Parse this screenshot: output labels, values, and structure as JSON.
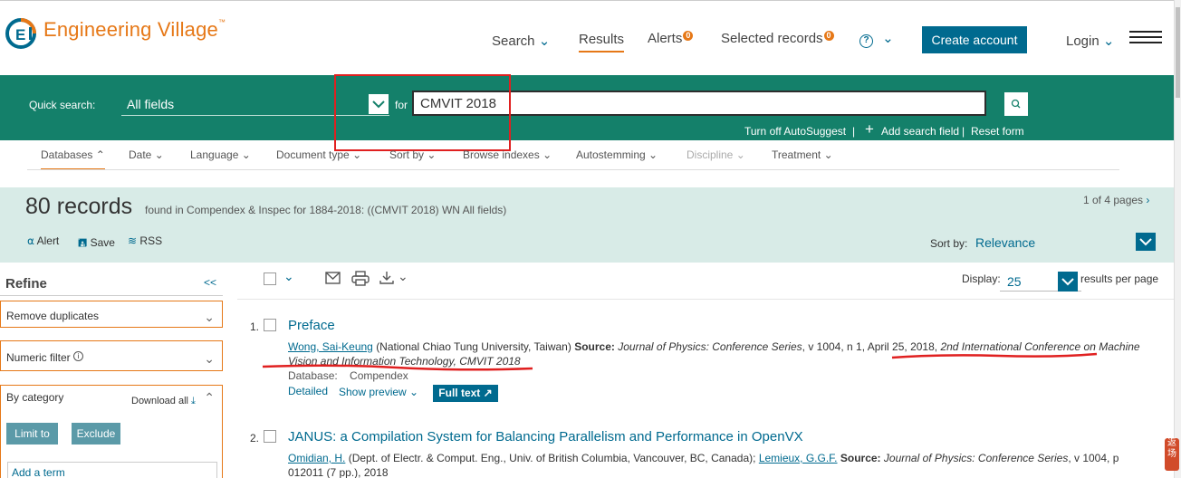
{
  "header": {
    "logo_text": "Engineering Village",
    "logo_tm": "™",
    "nav": {
      "search": "Search",
      "results": "Results",
      "alerts": "Alerts",
      "alerts_count": "0",
      "selected": "Selected records",
      "selected_count": "0",
      "help": "?",
      "create_account": "Create account",
      "login": "Login"
    }
  },
  "search": {
    "quick_label": "Quick search:",
    "field": "All fields",
    "for_label": "for",
    "query": "CMVIT 2018",
    "autosuggest": "Turn off AutoSuggest",
    "add_field": "Add search field",
    "reset": "Reset form"
  },
  "filters": [
    "Databases",
    "Date",
    "Language",
    "Document type",
    "Sort by",
    "Browse indexes",
    "Autostemming",
    "Discipline",
    "Treatment"
  ],
  "summary": {
    "count": "80 records",
    "found": "found in Compendex & Inspec for 1884-2018: ((CMVIT 2018) WN All fields)",
    "pages": "1 of 4 pages",
    "alert": "Alert",
    "save": "Save",
    "rss": "RSS",
    "sort_label": "Sort by:",
    "sort_value": "Relevance"
  },
  "refine": {
    "title": "Refine",
    "collapse": "<<",
    "remove_duplicates": "Remove duplicates",
    "numeric_filter": "Numeric filter",
    "by_category": "By category",
    "download_all": "Download all",
    "limit_to": "Limit to",
    "exclude": "Exclude",
    "add_term": "Add a term"
  },
  "toolbar": {
    "display_label": "Display:",
    "display_value": "25",
    "results_per_page": "results per page"
  },
  "results": [
    {
      "num": "1.",
      "title": "Preface",
      "author": "Wong, Sai-Keung",
      "affil": "(National Chiao Tung University, Taiwan)",
      "source_label": "Source:",
      "source": "Journal of Physics: Conference Series",
      "source_tail": ", v 1004, n 1, April 25, 2018,",
      "conf1": "2nd International Conference on Machine",
      "conf2": "Vision and Information Technology, CMVIT 2018",
      "db_label": "Database:",
      "db_value": "Compendex",
      "detailed": "Detailed",
      "show_preview": "Show preview",
      "full_text": "Full text"
    },
    {
      "num": "2.",
      "title": "JANUS: a Compilation System for Balancing Parallelism and Performance in OpenVX",
      "author": "Omidian, H.",
      "affil": "(Dept. of Electr. & Comput. Eng., Univ. of British Columbia, Vancouver, BC, Canada);",
      "author2": "Lemieux, G.G.F.",
      "source_label": "Source:",
      "source": "Journal of Physics: Conference Series",
      "source_tail": ", v 1004, p",
      "line2": "012011 (7 pp.), 2018"
    }
  ],
  "side_badge": "返场"
}
